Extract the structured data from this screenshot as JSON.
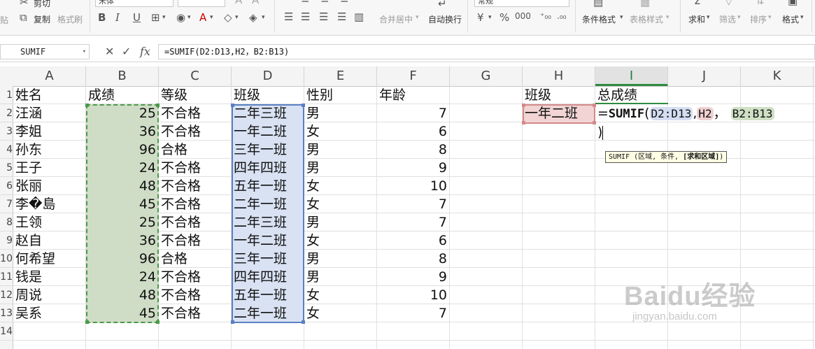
{
  "ribbon": {
    "cut": "剪切",
    "copy": "复制",
    "format_painter": "格式刷",
    "paste_partial": "贴",
    "font_name": "宋体",
    "merge_center": "合并居中",
    "wrap_text": "自动换行",
    "number_format": "常规",
    "conditional_format": "条件格式",
    "table_style": "表格样式",
    "sum": "求和",
    "filter": "筛选",
    "sort": "排序",
    "format": "格式"
  },
  "formula_bar": {
    "name_box": "SUMIF",
    "formula": "=SUMIF(D2:D13,H2，B2:B13)"
  },
  "columns": [
    "A",
    "B",
    "C",
    "D",
    "E",
    "F",
    "G",
    "H",
    "I",
    "J",
    "K"
  ],
  "active_column": "I",
  "rows": [
    "1",
    "2",
    "3",
    "4",
    "5",
    "6",
    "7",
    "8",
    "9",
    "10",
    "11",
    "12",
    "13",
    "14"
  ],
  "headers": {
    "name": "姓名",
    "score": "成绩",
    "grade": "等级",
    "class": "班级",
    "gender": "性别",
    "age": "年龄"
  },
  "data": [
    {
      "name": "汪涵",
      "score": "25",
      "grade": "不合格",
      "class": "二年三班",
      "gender": "男",
      "age": "7"
    },
    {
      "name": "李姐",
      "score": "36",
      "grade": "不合格",
      "class": "一年二班",
      "gender": "女",
      "age": "6"
    },
    {
      "name": "孙东",
      "score": "96",
      "grade": "合格",
      "class": "三年一班",
      "gender": "男",
      "age": "8"
    },
    {
      "name": "王子",
      "score": "24",
      "grade": "不合格",
      "class": "四年四班",
      "gender": "男",
      "age": "9"
    },
    {
      "name": "张丽",
      "score": "48",
      "grade": "不合格",
      "class": "五年一班",
      "gender": "女",
      "age": "10"
    },
    {
      "name": "李�島",
      "score": "45",
      "grade": "不合格",
      "class": "二年一班",
      "gender": "女",
      "age": "7"
    },
    {
      "name": "王领",
      "score": "25",
      "grade": "不合格",
      "class": "二年三班",
      "gender": "男",
      "age": "7"
    },
    {
      "name": "赵自",
      "score": "36",
      "grade": "不合格",
      "class": "一年二班",
      "gender": "女",
      "age": "6"
    },
    {
      "name": "何希望",
      "score": "96",
      "grade": "合格",
      "class": "三年一班",
      "gender": "男",
      "age": "8"
    },
    {
      "name": "钱是",
      "score": "24",
      "grade": "不合格",
      "class": "四年四班",
      "gender": "男",
      "age": "9"
    },
    {
      "name": "周说",
      "score": "48",
      "grade": "不合格",
      "class": "五年一班",
      "gender": "女",
      "age": "10"
    },
    {
      "name": "吴系",
      "score": "45",
      "grade": "不合格",
      "class": "二年一班",
      "gender": "女",
      "age": "7"
    }
  ],
  "lookup": {
    "class_header": "班级",
    "total_header": "总成绩",
    "class_value": "一年二班"
  },
  "editing": {
    "prefix": "=",
    "fn": "SUMIF",
    "open_paren": "(",
    "arg1": "D2:D13",
    "comma1": ",",
    "arg2": "H2",
    "comma2": "，",
    "arg3": "B2:B13",
    "close_paren": ")"
  },
  "tooltip": {
    "text": "SUMIF (区域, 条件, ",
    "optional": "[求和区域]",
    "end": ")"
  },
  "watermark": {
    "logo": "Baidu经验",
    "url": "jingyan.baidu.com"
  },
  "colors": {
    "range_green": "#cfdcc6",
    "range_blue": "#d9e2f3",
    "range_red": "#f2d4d4",
    "active_green": "#2e8b3e"
  }
}
